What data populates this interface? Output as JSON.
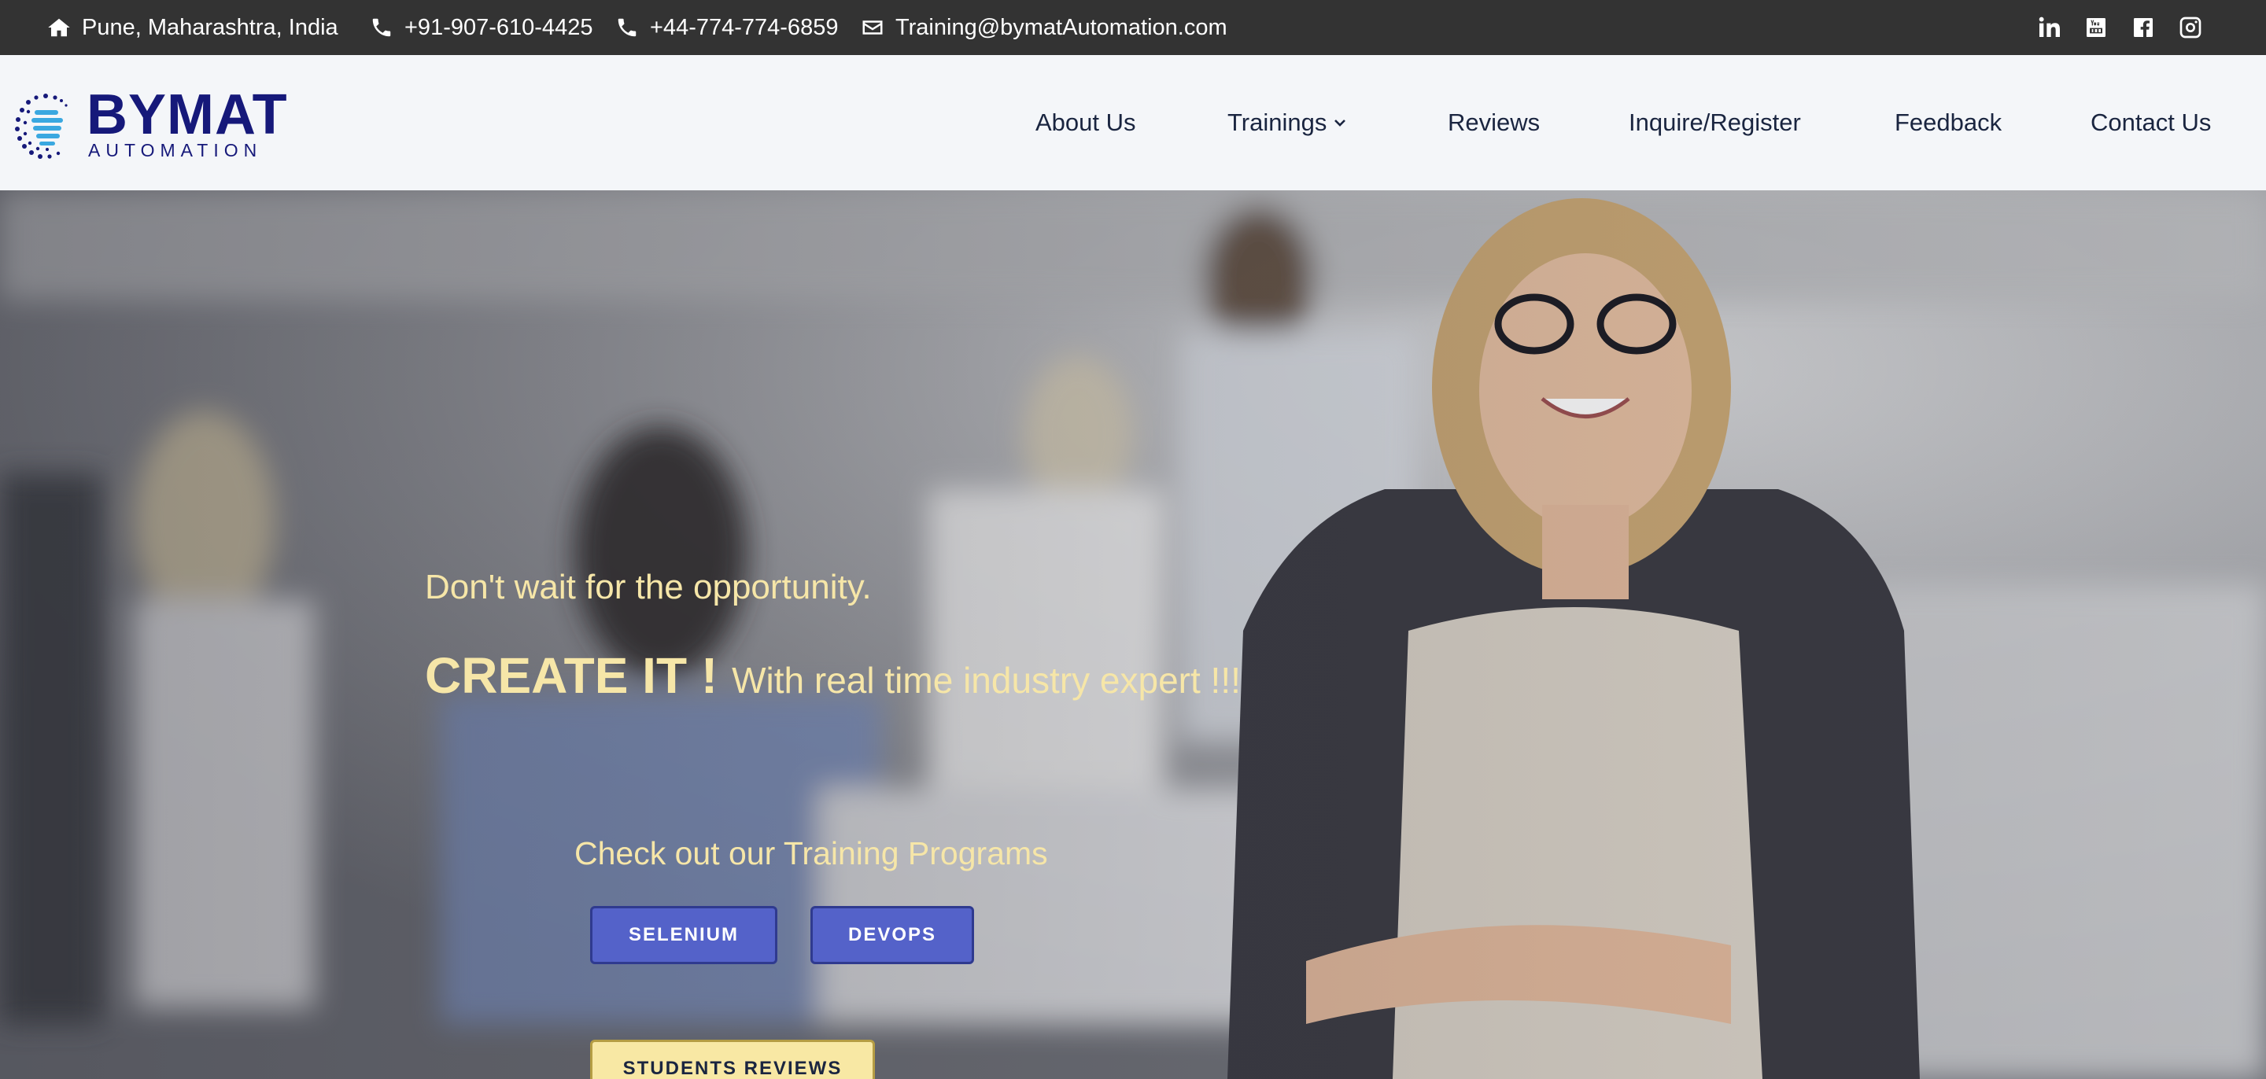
{
  "topbar": {
    "location": "Pune, Maharashtra, India",
    "phone_in": "+91-907-610-4425",
    "phone_uk": "+44-774-774-6859",
    "email": "Training@bymatAutomation.com",
    "socials": [
      "linkedin-icon",
      "youtube-icon",
      "facebook-icon",
      "instagram-icon"
    ]
  },
  "logo": {
    "word": "BYMAT",
    "sub": "AUTOMATION"
  },
  "nav": {
    "about": "About Us",
    "trainings": "Trainings",
    "reviews": "Reviews",
    "inquire": "Inquire/Register",
    "feedback": "Feedback",
    "contact": "Contact Us"
  },
  "hero": {
    "tagline": "Don't wait for the opportunity.",
    "headline_big": "CREATE IT !",
    "headline_small": "With real time industry expert !!!",
    "check_out": "Check out our Training Programs",
    "btn_selenium": "SELENIUM",
    "btn_devops": "DEVOPS",
    "btn_reviews": "STUDENTS REVIEWS"
  },
  "colors": {
    "topbar_bg": "#333333",
    "brand": "#16197a",
    "hero_text": "#f6e6a8",
    "button_blue": "#5462c9",
    "button_yellow": "#f8e8a4"
  }
}
